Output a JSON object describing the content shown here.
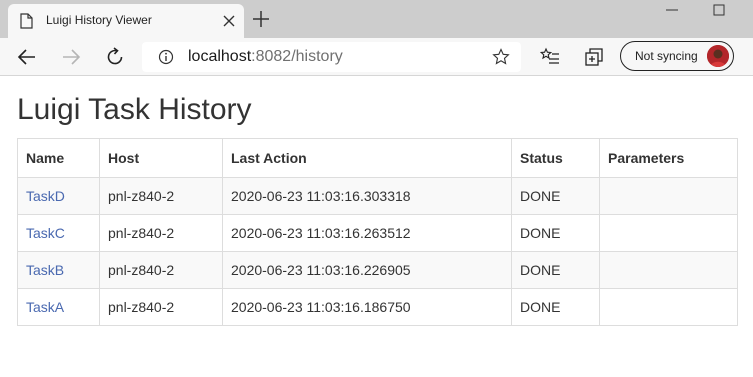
{
  "browser": {
    "tab_title": "Luigi History Viewer",
    "url_host": "localhost",
    "url_rest": ":8082/history",
    "profile_label": "Not syncing",
    "icons": {
      "tab": "page-icon",
      "close": "close-icon",
      "new_tab": "plus-icon",
      "back": "back-arrow-icon",
      "forward": "forward-arrow-icon",
      "refresh": "refresh-icon",
      "info": "info-icon",
      "favorite": "star-icon",
      "favorites_bar": "favorites-list-icon",
      "collections": "collections-icon",
      "minimize": "minimize-icon",
      "maximize": "maximize-icon"
    }
  },
  "page": {
    "title": "Luigi Task History",
    "table": {
      "headers": [
        "Name",
        "Host",
        "Last Action",
        "Status",
        "Parameters"
      ],
      "rows": [
        {
          "name": "TaskD",
          "host": "pnl-z840-2",
          "last_action": "2020-06-23 11:03:16.303318",
          "status": "DONE",
          "parameters": ""
        },
        {
          "name": "TaskC",
          "host": "pnl-z840-2",
          "last_action": "2020-06-23 11:03:16.263512",
          "status": "DONE",
          "parameters": ""
        },
        {
          "name": "TaskB",
          "host": "pnl-z840-2",
          "last_action": "2020-06-23 11:03:16.226905",
          "status": "DONE",
          "parameters": ""
        },
        {
          "name": "TaskA",
          "host": "pnl-z840-2",
          "last_action": "2020-06-23 11:03:16.186750",
          "status": "DONE",
          "parameters": ""
        }
      ]
    }
  },
  "colors": {
    "link": "#4a69b0",
    "row_stripe": "#f9f9f9",
    "border": "#dddddd"
  }
}
